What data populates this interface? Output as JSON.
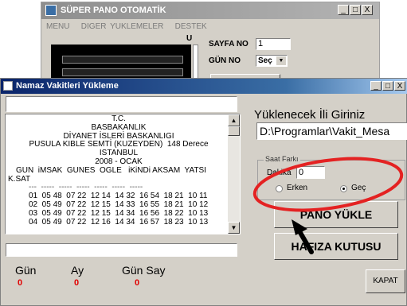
{
  "background_window": {
    "title": "SÜPER PANO OTOMATİK",
    "menu": [
      "MENU",
      "DIGER YUKLEMELER",
      "DESTEK"
    ],
    "caption_buttons": [
      "_",
      "□",
      "X"
    ],
    "u_label": "U",
    "sayfa_no_label": "SAYFA NO",
    "sayfa_no_value": "1",
    "gun_no_label": "GÜN NO",
    "gun_no_select": "Seç"
  },
  "main_window": {
    "title": "Namaz Vakitleri Yükleme",
    "caption_buttons": [
      "_",
      "□",
      "X"
    ],
    "top_input_value": "",
    "memo": {
      "header_lines": [
        "T.C.",
        "BASBAKANLIK",
        "DİYANET İSLERİ BASKANLIGI",
        "PUSULA KIBLE SEMTİ (KUZEYDEN)  148 Derece",
        "ISTANBUL",
        "2008 - OCAK"
      ],
      "columns_line": "GUN  iMSAK  GUNES  OGLE   iKiNDi AKSAM  YATSI",
      "columns_line2": "K.SAT",
      "separator": "---  -----  -----  -----  -----  -----  -----",
      "rows": [
        "01  05 48  07 22  12 14  14 32  16 54  18 21  10 11",
        "02  05 49  07 22  12 15  14 33  16 55  18 21  10 12",
        "03  05 49  07 22  12 15  14 34  16 56  18 22  10 13",
        "04  05 49  07 22  12 16  14 34  16 57  18 23  10 13"
      ]
    },
    "bottom_input_value": "",
    "gun_label": "Gün",
    "gun_value": "0",
    "ay_label": "Ay",
    "ay_value": "0",
    "gun_say_label": "Gün Say",
    "gun_say_value": "0",
    "il_heading": "Yüklenecek İli Giriniz",
    "path_value": "D:\\Programlar\\Vakit_Mesa",
    "saat_farki_label": "Saat Farkı",
    "dakika_label": "Dakika",
    "dakika_value": "0",
    "radio_erken": "Erken",
    "radio_gec": "Geç",
    "selected_radio": "Geç",
    "pano_yukle_button": "PANO YÜKLE",
    "hafiza_button": "HAFIZA KUTUSU",
    "kapat_button": "KAPAT"
  },
  "colors": {
    "title_active": "#0a246a",
    "dialog_face": "#d4d0c8",
    "value_red": "#e00000",
    "annotation_red": "#e42222"
  },
  "icons": [
    "app-icon",
    "scroll-up-icon",
    "scroll-down-icon",
    "dropdown-arrow-icon",
    "arrow-pointer-icon",
    "red-ellipse-annotation"
  ]
}
